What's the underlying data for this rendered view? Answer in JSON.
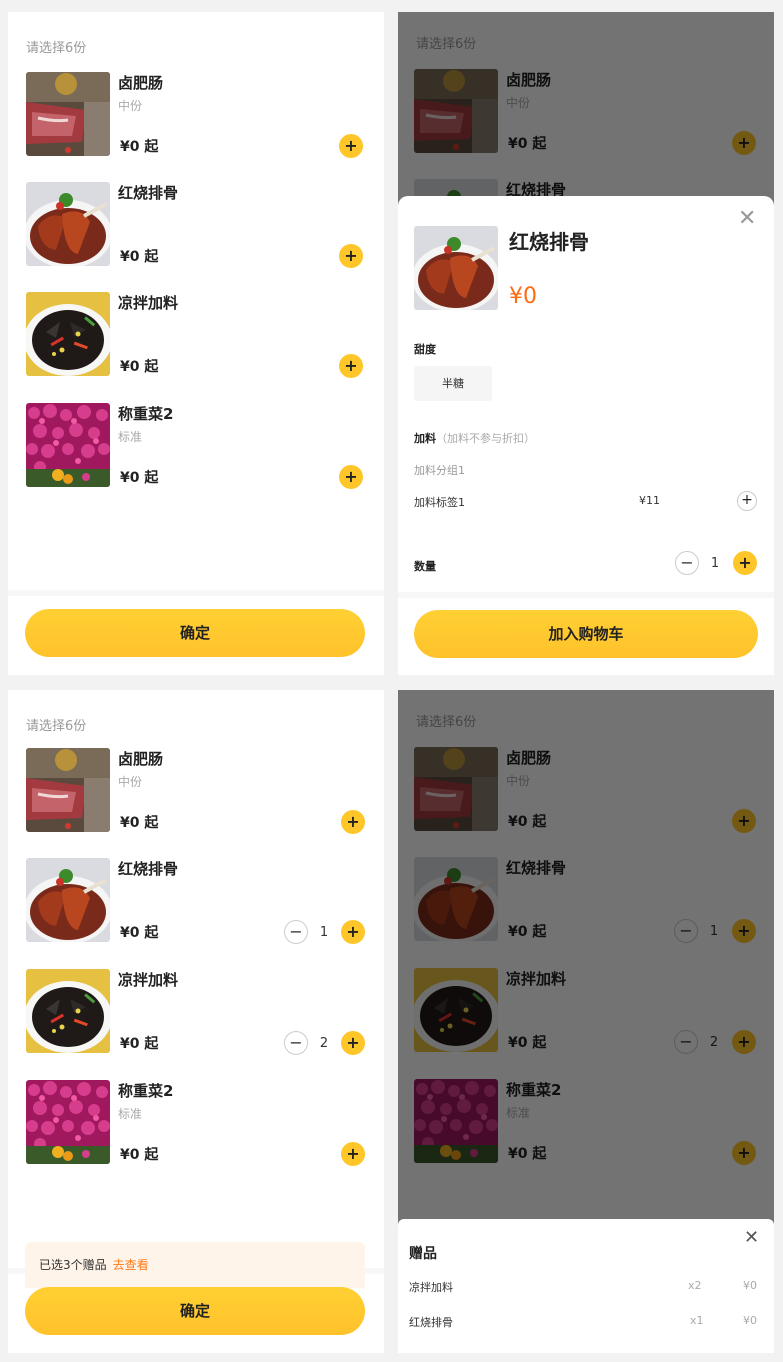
{
  "hint": "请选择6份",
  "confirm_label": "确定",
  "items": [
    {
      "name": "卤肥肠",
      "spec": "中份",
      "price": "¥0 起"
    },
    {
      "name": "红烧排骨",
      "spec": "",
      "price": "¥0 起"
    },
    {
      "name": "凉拌加料",
      "spec": "",
      "price": "¥0 起"
    },
    {
      "name": "称重菜2",
      "spec": "标准",
      "price": "¥0 起"
    }
  ],
  "plus_glyph": "+",
  "minus_glyph": "−",
  "selected_qty": {
    "ribs": "1",
    "salad": "2"
  },
  "sheet": {
    "name": "红烧排骨",
    "price": "¥0",
    "sweetness_label": "甜度",
    "sweetness_option": "半糖",
    "toppings_label": "加料",
    "toppings_note": "（加料不参与折扣）",
    "topping_group": "加料分组1",
    "topping_tag": "加料标签1",
    "topping_price": "¥11",
    "qty_label": "数量",
    "qty": "1",
    "add_to_cart": "加入购物车",
    "close_glyph": "✕"
  },
  "gift_bar": {
    "text": "已选3个赠品",
    "link": "去查看"
  },
  "gift_sheet": {
    "title": "赠品",
    "close_glyph": "✕",
    "rows": [
      {
        "name": "凉拌加料",
        "count": "x2",
        "price": "¥0"
      },
      {
        "name": "红烧排骨",
        "count": "x1",
        "price": "¥0"
      }
    ]
  },
  "icons": {
    "plus": "plus-icon",
    "minus": "minus-icon",
    "close": "close-icon"
  },
  "colors": {
    "accent": "#ffc629",
    "price_orange": "#ff6a12",
    "gift_bar_bg": "#fff4e9"
  }
}
